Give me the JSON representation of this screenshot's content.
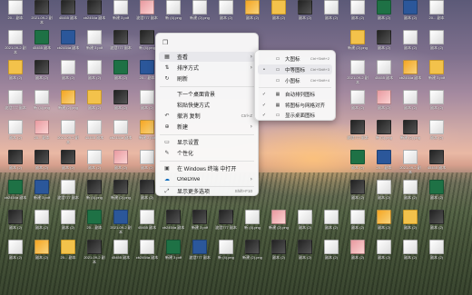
{
  "desktop": {
    "icons": [
      {
        "t": "light",
        "c": "20... 副本"
      },
      {
        "t": "dark",
        "c": "2021-09-2 副本"
      },
      {
        "t": "dark",
        "c": "45455 副本"
      },
      {
        "t": "dark",
        "c": "cb2454a 副本"
      },
      {
        "t": "light",
        "c": "新建 3 pdf"
      },
      {
        "t": "light",
        "c": "波澄777 副本"
      },
      {
        "t": "light",
        "c": "新 (4).png"
      },
      {
        "t": "light",
        "c": "新建 (2).png"
      },
      {
        "t": "dark",
        "c": "副本 (2)"
      },
      {
        "t": "light",
        "c": "副本 (2)"
      },
      {
        "t": "light",
        "c": "副本 (2)"
      },
      {
        "t": "light",
        "c": "副本 (2)"
      },
      {
        "t": "light",
        "c": "副本 (2)"
      },
      {
        "t": "light",
        "c": "副本 (2)"
      },
      {
        "t": "light",
        "c": "副本 (2)"
      },
      {
        "t": "light",
        "c": "副本 (2)"
      }
    ]
  },
  "context_menu": {
    "items": [
      {
        "key": "view",
        "icon": "▦",
        "label": "查看",
        "shortcut": "",
        "arrow": "›",
        "highlight": true
      },
      {
        "key": "sort",
        "icon": "⇅",
        "label": "排序方式",
        "shortcut": "",
        "arrow": "›",
        "highlight": false
      },
      {
        "key": "refresh",
        "icon": "↻",
        "label": "刷新",
        "shortcut": "",
        "arrow": "",
        "highlight": false
      },
      {
        "key": "next-bg",
        "icon": "",
        "label": "下一个桌面背景",
        "shortcut": "",
        "arrow": "",
        "highlight": false
      },
      {
        "key": "paste-shortcut",
        "icon": "",
        "label": "粘贴快捷方式",
        "shortcut": "",
        "arrow": "",
        "highlight": false
      },
      {
        "key": "undo-copy",
        "icon": "↶",
        "label": "撤消 复制",
        "shortcut": "Ctrl+Z",
        "arrow": "",
        "highlight": false
      },
      {
        "key": "new",
        "icon": "⊕",
        "label": "新建",
        "shortcut": "",
        "arrow": "›",
        "highlight": false
      },
      {
        "key": "display",
        "icon": "▭",
        "label": "显示设置",
        "shortcut": "",
        "arrow": "",
        "highlight": false
      },
      {
        "key": "personalize",
        "icon": "✎",
        "label": "个性化",
        "shortcut": "",
        "arrow": "",
        "highlight": false
      },
      {
        "key": "terminal",
        "icon": "▣",
        "label": "在 Windows 终端 中打开",
        "shortcut": "",
        "arrow": "",
        "highlight": false
      },
      {
        "key": "onedrive",
        "icon": "☁",
        "label": "OneDrive",
        "shortcut": "",
        "arrow": "›",
        "highlight": false
      },
      {
        "key": "more",
        "icon": "⤢",
        "label": "显示更多选项",
        "shortcut": "Shift+F10",
        "arrow": "",
        "highlight": false
      }
    ]
  },
  "view_submenu": {
    "items": [
      {
        "key": "large",
        "icon": "▭",
        "label": "大图标",
        "shortcut": "Ctrl+Shift+2",
        "check": ""
      },
      {
        "key": "medium",
        "icon": "▭",
        "label": "中等图标",
        "shortcut": "Ctrl+Shift+3",
        "check": "•"
      },
      {
        "key": "small",
        "icon": "▭",
        "label": "小图标",
        "shortcut": "Ctrl+Shift+4",
        "check": ""
      },
      {
        "key": "auto",
        "icon": "▦",
        "label": "自动排列图标",
        "shortcut": "",
        "check": "✓"
      },
      {
        "key": "align",
        "icon": "▦",
        "label": "将图标与网格对齐",
        "shortcut": "",
        "check": "✓"
      },
      {
        "key": "show",
        "icon": "▭",
        "label": "显示桌面图标",
        "shortcut": "",
        "check": "✓"
      }
    ]
  }
}
